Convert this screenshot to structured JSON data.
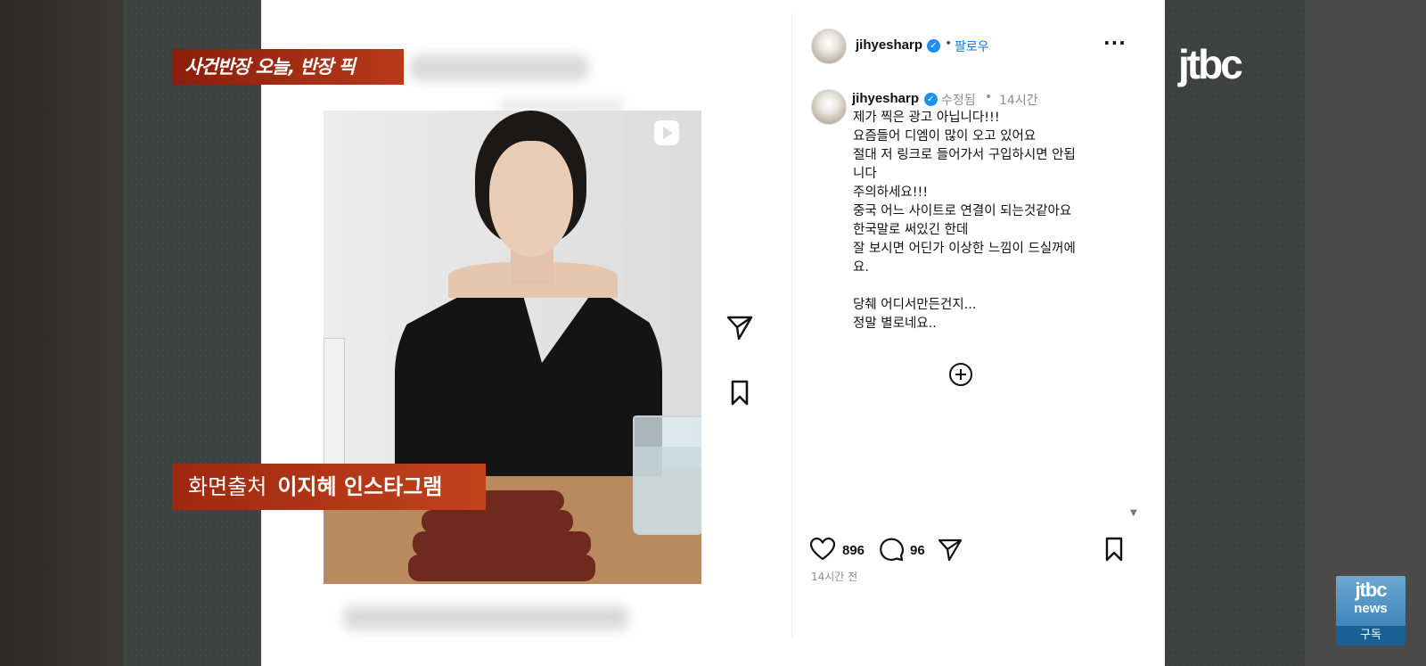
{
  "broadcast": {
    "segment_tag": "사건반장 오늘, 반장 픽",
    "source_prefix": "화면출처",
    "source_name": "이지혜 인스타그램",
    "channel_logo": "jtbc",
    "badge_logo": "jtbc",
    "badge_sub": "news",
    "subscribe_label": "구독"
  },
  "post": {
    "header": {
      "username": "jihyesharp",
      "verified": true,
      "follow_label": "팔로우",
      "more_icon": "more-horizontal-icon"
    },
    "caption": {
      "username": "jihyesharp",
      "edited_label": "수정됨",
      "time_label": "14시간",
      "lines": [
        "제가 찍은 광고 아닙니다!!!",
        "요즘들어 디엠이 많이 오고 있어요",
        "절대 저 링크로 들어가서 구입하시면 안됩",
        "니다",
        "주의하세요!!!",
        "중국 어느 사이트로 연결이 되는것같아요",
        "한국말로 써있긴 한데",
        "잘 보시면 어딘가 이상한 느낌이 드실꺼에",
        "요.",
        "",
        "당췌 어디서만든건지...",
        "정말 별로네요.."
      ]
    },
    "actions": {
      "like_count": "896",
      "comment_count": "96",
      "posted_time": "14시간 전"
    },
    "icons": {
      "reel": "reel-play-icon",
      "share": "send-icon",
      "save": "bookmark-icon",
      "add": "add-circle-icon",
      "like": "heart-icon",
      "comment": "comment-icon"
    }
  },
  "colors": {
    "link_blue": "#0b74e5",
    "verified_blue": "#1f8ef1",
    "tag_red": "#b83a1a"
  }
}
